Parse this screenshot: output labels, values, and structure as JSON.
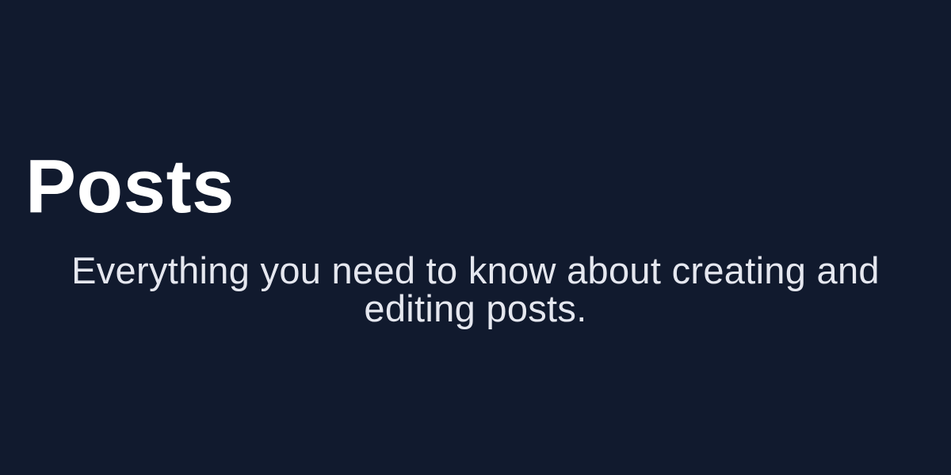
{
  "page": {
    "title": "Posts",
    "subtitle": "Everything you need to know about creating and editing posts."
  },
  "colors": {
    "background": "#111a2e",
    "title": "#ffffff",
    "subtitle": "#e5e7ef"
  }
}
